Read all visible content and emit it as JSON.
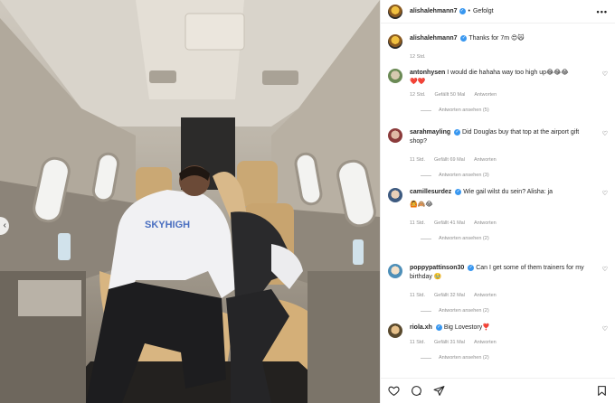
{
  "post": {
    "author": "alishalehmann7",
    "follow_status": "Gefolgt",
    "more_glyph": "•••",
    "verified_glyph": "✓",
    "separator": "•",
    "prev_glyph": "‹",
    "caption": {
      "text": "Thanks for 7m 😍🙀",
      "time": "12 Std."
    }
  },
  "comments": [
    {
      "user": "antonhysen",
      "verified": false,
      "text": "I would die hahaha way too high up😂😂😂",
      "extra": "❤️❤️",
      "time": "12 Std.",
      "likes": "Gefällt 50 Mal",
      "reply": "Antworten",
      "replies": "Antworten ansehen (5)"
    },
    {
      "user": "sarahmayling",
      "verified": true,
      "text": "Did Douglas buy that top at the airport gift shop?",
      "extra": "",
      "time": "11 Std.",
      "likes": "Gefällt 69 Mal",
      "reply": "Antworten",
      "replies": "Antworten ansehen (3)"
    },
    {
      "user": "camillesurdez",
      "verified": true,
      "text": "Wie gail wilst du sein? Alisha: ja",
      "extra": "🙆🙈😂",
      "time": "11 Std.",
      "likes": "Gefällt 41 Mal",
      "reply": "Antworten",
      "replies": "Antworten ansehen (2)"
    },
    {
      "user": "poppypattinson30",
      "verified": true,
      "text": "Can I get some of them trainers for my birthday 🥹",
      "extra": "",
      "time": "11 Std.",
      "likes": "Gefällt 32 Mal",
      "reply": "Antworten",
      "replies": "Antworten ansehen (2)"
    },
    {
      "user": "riola.xh",
      "verified": true,
      "text": "Big Lovestory❣️",
      "extra": "",
      "time": "11 Std.",
      "likes": "Gefällt 31 Mal",
      "reply": "Antworten",
      "replies": "Antworten ansehen (2)"
    }
  ],
  "photo_text": {
    "sweater_print": "SKYHIGH"
  },
  "icons": {
    "like": "heart-icon",
    "comment": "comment-icon",
    "share": "share-icon",
    "save": "bookmark-icon",
    "more": "more-icon",
    "prev": "chevron-left-icon"
  },
  "colors": {
    "verified": "#3897f0",
    "muted": "#8e8e8e",
    "border": "#efefef"
  }
}
